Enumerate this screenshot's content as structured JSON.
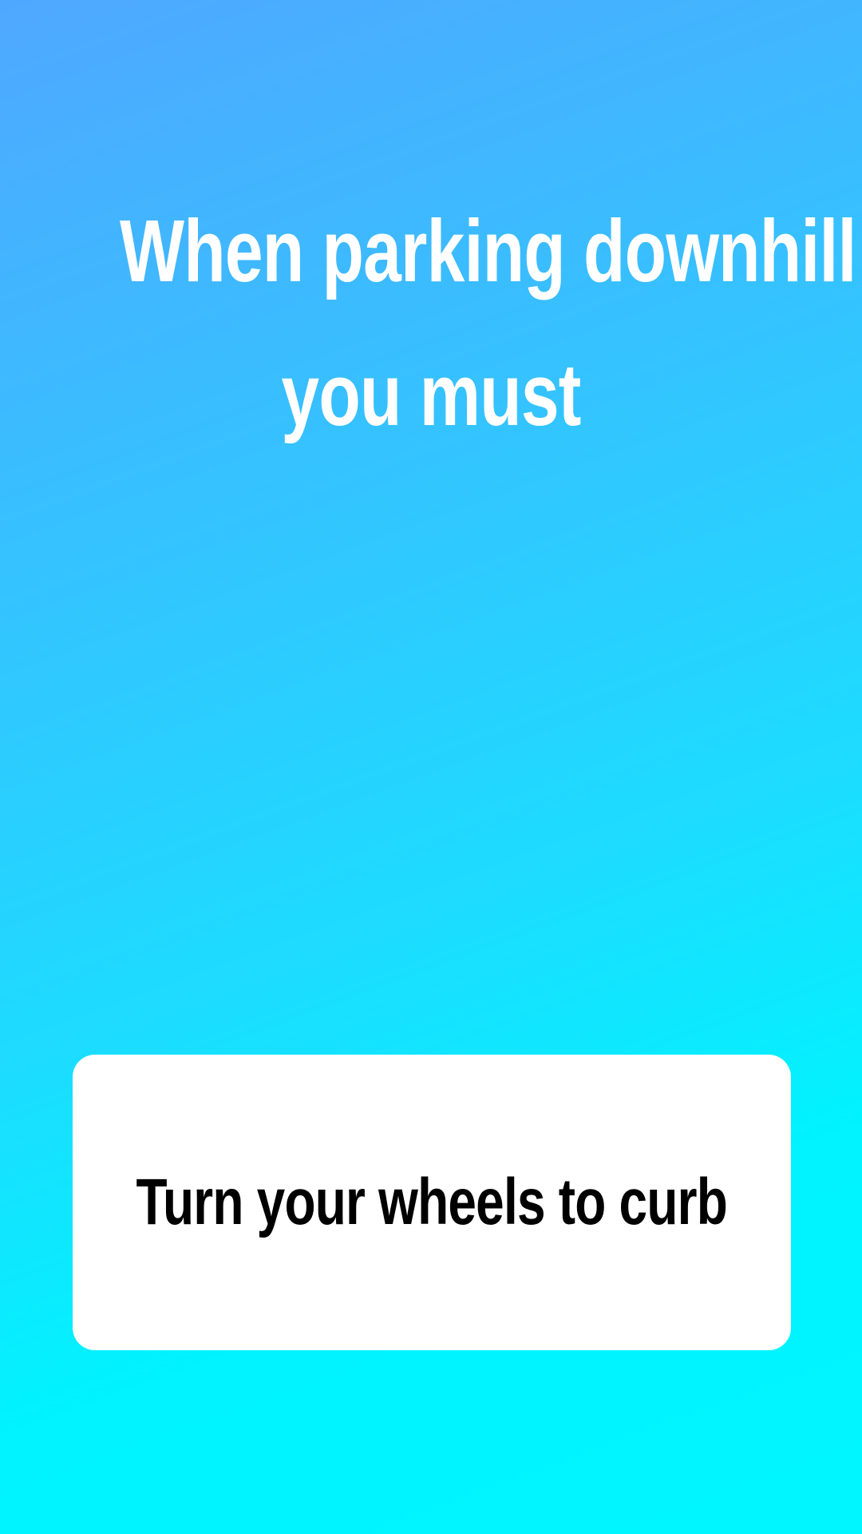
{
  "question": {
    "lines": [
      "When parking downhill",
      "you must"
    ]
  },
  "answer": {
    "label": "Turn your wheels to curb"
  },
  "colors": {
    "background_top": "#4fa8ff",
    "background_bottom": "#00f6ff",
    "question_text": "#ffffff",
    "card_background": "#ffffff",
    "answer_text": "#000000"
  }
}
